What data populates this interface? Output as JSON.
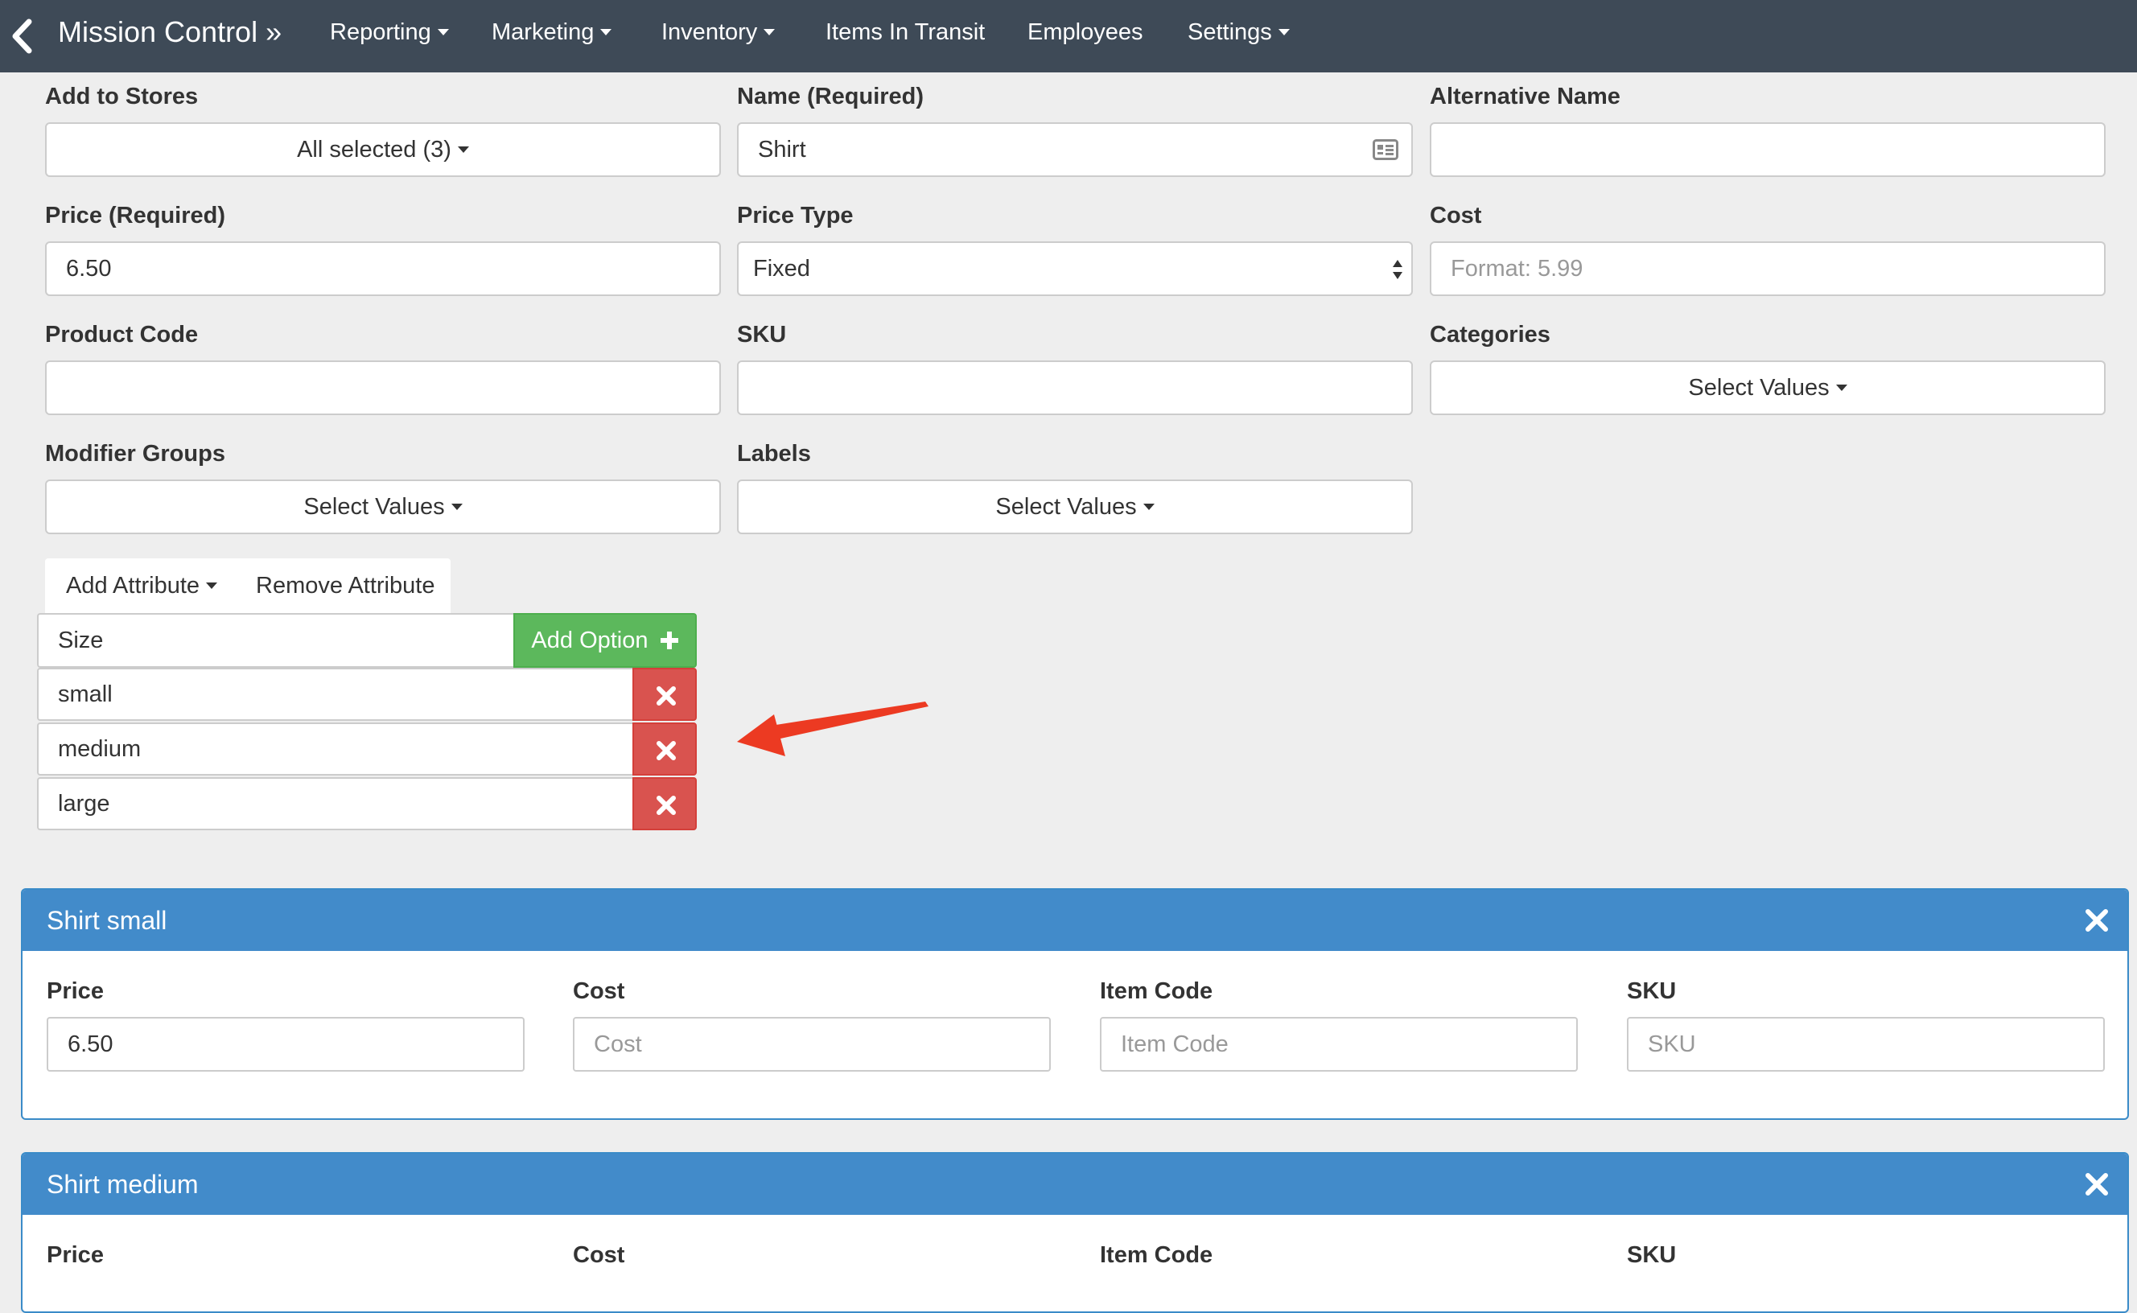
{
  "nav": {
    "brand": "Mission Control »",
    "items": [
      {
        "label": "Reporting",
        "dropdown": true
      },
      {
        "label": "Marketing",
        "dropdown": true
      },
      {
        "label": "Inventory",
        "dropdown": true
      },
      {
        "label": "Items In Transit",
        "dropdown": false
      },
      {
        "label": "Employees",
        "dropdown": false
      },
      {
        "label": "Settings",
        "dropdown": true
      }
    ]
  },
  "form": {
    "add_to_stores": {
      "label": "Add to Stores",
      "value": "All selected (3)"
    },
    "name": {
      "label": "Name (Required)",
      "value": "Shirt"
    },
    "alternative_name": {
      "label": "Alternative Name",
      "value": ""
    },
    "price": {
      "label": "Price (Required)",
      "value": "6.50"
    },
    "price_type": {
      "label": "Price Type",
      "value": "Fixed"
    },
    "cost": {
      "label": "Cost",
      "placeholder": "Format: 5.99"
    },
    "product_code": {
      "label": "Product Code",
      "value": ""
    },
    "sku": {
      "label": "SKU",
      "value": ""
    },
    "categories": {
      "label": "Categories",
      "value": "Select Values"
    },
    "modifier_groups": {
      "label": "Modifier Groups",
      "value": "Select Values"
    },
    "labels": {
      "label": "Labels",
      "value": "Select Values"
    }
  },
  "attributes": {
    "add_attribute": "Add Attribute",
    "remove_attribute": "Remove Attribute",
    "name": "Size",
    "add_option": "Add Option",
    "options": [
      "small",
      "medium",
      "large"
    ]
  },
  "variants": [
    {
      "title": "Shirt small",
      "fields": {
        "price_label": "Price",
        "price_value": "6.50",
        "cost_label": "Cost",
        "cost_placeholder": "Cost",
        "item_code_label": "Item Code",
        "item_code_placeholder": "Item Code",
        "sku_label": "SKU",
        "sku_placeholder": "SKU"
      }
    },
    {
      "title": "Shirt medium",
      "fields": {
        "price_label": "Price",
        "cost_label": "Cost",
        "item_code_label": "Item Code",
        "sku_label": "SKU"
      }
    }
  ],
  "colors": {
    "navbar": "#3e4a57",
    "success": "#5cb85c",
    "danger": "#d9534f",
    "panel_header": "#428bca",
    "annotation_arrow": "#ec3a22"
  },
  "icons": {
    "back": "chevron-left-icon",
    "name_field": "id-card-icon",
    "add_option": "plus-icon",
    "remove_option": "times-icon",
    "panel_close": "close-icon"
  }
}
